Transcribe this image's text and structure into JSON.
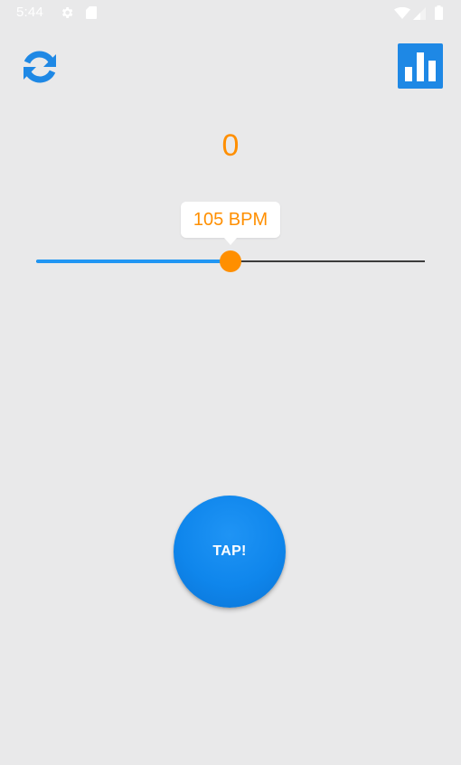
{
  "status_bar": {
    "time": "5:44",
    "icons": [
      "gear-icon",
      "sd-card-icon",
      "wifi-icon",
      "signal-icon",
      "battery-icon"
    ]
  },
  "toolbar": {
    "refresh_icon": "refresh-icon",
    "stats_icon": "bar-chart-icon"
  },
  "counter": {
    "value": "0"
  },
  "tempo": {
    "label": "105 BPM",
    "slider_fraction": 0.5
  },
  "tap_button": {
    "label": "TAP!"
  },
  "colors": {
    "accent_orange": "#ff8f00",
    "primary_blue": "#1e88e5",
    "background": "#e9e9ea"
  }
}
